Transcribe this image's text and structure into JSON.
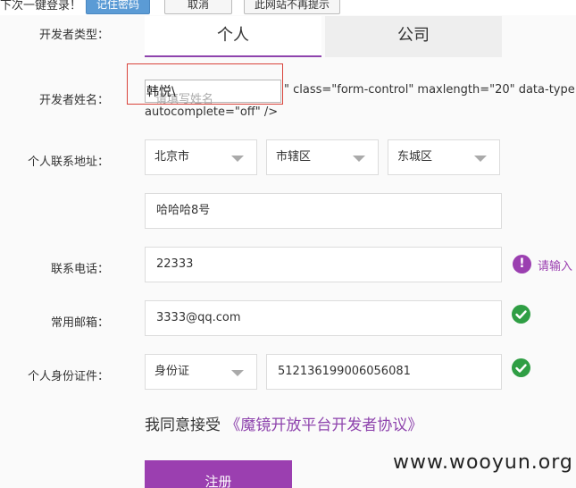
{
  "save_bar": {
    "prompt": "下次一键登录！",
    "remember_label": "记住密码",
    "cancel_label": "取消",
    "never_label": "此网站不再提示"
  },
  "form": {
    "type_label": "开发者类型：",
    "tabs": [
      {
        "label": "个人",
        "active": true
      },
      {
        "label": "公司",
        "active": false
      }
    ],
    "name_label": "开发者姓名：",
    "name_value": "韩悦\\",
    "name_placeholder": "请填写姓名",
    "leaked_markup_line1": "\" class=\"form-control\" maxlength=\"20\" data-type",
    "leaked_markup_line2": "autocomplete=\"off\" />",
    "address_label": "个人联系地址：",
    "province": "北京市",
    "city": "市辖区",
    "district": "东城区",
    "street": "哈哈哈8号",
    "phone_label": "联系电话：",
    "phone_value": "22333",
    "phone_hint": "请输入",
    "email_label": "常用邮箱：",
    "email_value": "3333@qq.com",
    "id_label": "个人身份证件：",
    "id_type": "身份证",
    "id_number": "512136199006056081",
    "agree_prefix": "我同意接受",
    "agreement_link": "《魔镜开放平台开发者协议》",
    "register_label": "注册"
  },
  "watermark": "www.wooyun.org",
  "colors": {
    "accent": "#9b3fb0",
    "success": "#2f9e44",
    "highlight_box": "#d9433b",
    "link": "#8e44ad"
  }
}
